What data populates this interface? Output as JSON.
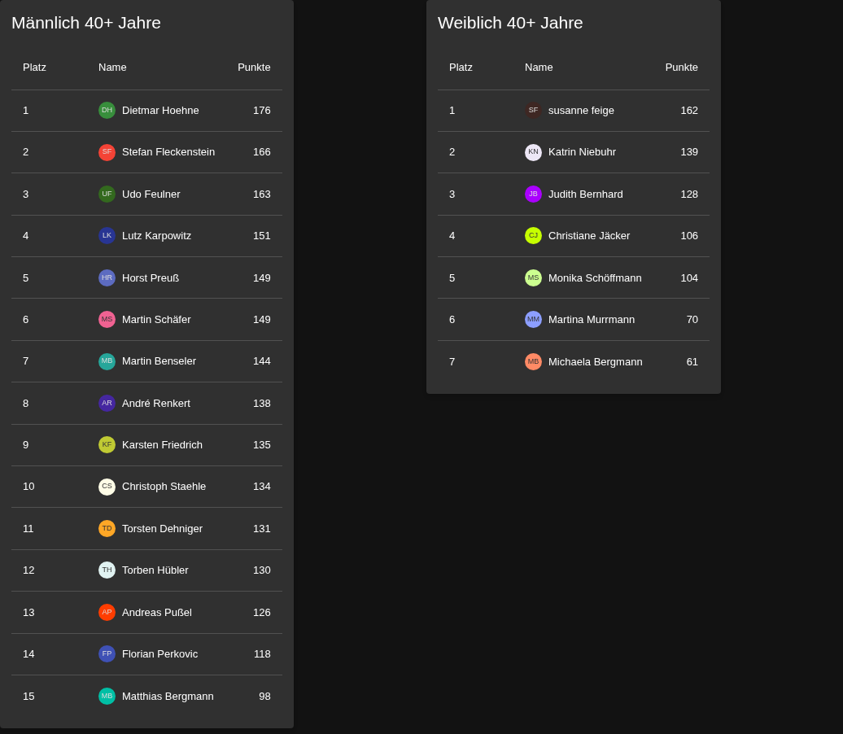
{
  "panels": [
    {
      "title": "Männlich 40+ Jahre",
      "columns": [
        "Platz",
        "Name",
        "Punkte"
      ],
      "rows": [
        {
          "rank": "1",
          "initials": "DH",
          "name": "Dietmar Hoehne",
          "points": "176",
          "color": "#388e3c"
        },
        {
          "rank": "2",
          "initials": "SF",
          "name": "Stefan Fleckenstein",
          "points": "166",
          "color": "#f44336"
        },
        {
          "rank": "3",
          "initials": "UF",
          "name": "Udo Feulner",
          "points": "163",
          "color": "#33691e"
        },
        {
          "rank": "4",
          "initials": "LK",
          "name": "Lutz Karpowitz",
          "points": "151",
          "color": "#283593"
        },
        {
          "rank": "5",
          "initials": "HR",
          "name": "Horst Preuß",
          "points": "149",
          "color": "#5c6bc0"
        },
        {
          "rank": "6",
          "initials": "MS",
          "name": "Martin Schäfer",
          "points": "149",
          "color": "#f06292"
        },
        {
          "rank": "7",
          "initials": "MB",
          "name": "Martin Benseler",
          "points": "144",
          "color": "#26a69a"
        },
        {
          "rank": "8",
          "initials": "AR",
          "name": "André Renkert",
          "points": "138",
          "color": "#4527a0"
        },
        {
          "rank": "9",
          "initials": "KF",
          "name": "Karsten Friedrich",
          "points": "135",
          "color": "#c0ca33"
        },
        {
          "rank": "10",
          "initials": "CS",
          "name": "Christoph Staehle",
          "points": "134",
          "color": "#fffde7"
        },
        {
          "rank": "11",
          "initials": "TD",
          "name": "Torsten Dehniger",
          "points": "131",
          "color": "#ffa726"
        },
        {
          "rank": "12",
          "initials": "TH",
          "name": "Torben Hübler",
          "points": "130",
          "color": "#e0f2f1"
        },
        {
          "rank": "13",
          "initials": "AP",
          "name": "Andreas Pußel",
          "points": "126",
          "color": "#ff3d00"
        },
        {
          "rank": "14",
          "initials": "FP",
          "name": "Florian Perkovic",
          "points": "118",
          "color": "#3f51b5"
        },
        {
          "rank": "15",
          "initials": "MB",
          "name": "Matthias Bergmann",
          "points": "98",
          "color": "#00bfa5"
        }
      ]
    },
    {
      "title": "Weiblich 40+ Jahre",
      "columns": [
        "Platz",
        "Name",
        "Punkte"
      ],
      "rows": [
        {
          "rank": "1",
          "initials": "SF",
          "name": "susanne feige",
          "points": "162",
          "color": "#3e2723"
        },
        {
          "rank": "2",
          "initials": "KN",
          "name": "Katrin Niebuhr",
          "points": "139",
          "color": "#ede7f6"
        },
        {
          "rank": "3",
          "initials": "JB",
          "name": "Judith Bernhard",
          "points": "128",
          "color": "#aa00ff"
        },
        {
          "rank": "4",
          "initials": "CJ",
          "name": "Christiane Jäcker",
          "points": "106",
          "color": "#c6ff00"
        },
        {
          "rank": "5",
          "initials": "MS",
          "name": "Monika Schöffmann",
          "points": "104",
          "color": "#ccff90"
        },
        {
          "rank": "6",
          "initials": "MM",
          "name": "Martina Murrmann",
          "points": "70",
          "color": "#8c9eff"
        },
        {
          "rank": "7",
          "initials": "MB",
          "name": "Michaela Bergmann",
          "points": "61",
          "color": "#ff8a65"
        }
      ]
    }
  ]
}
